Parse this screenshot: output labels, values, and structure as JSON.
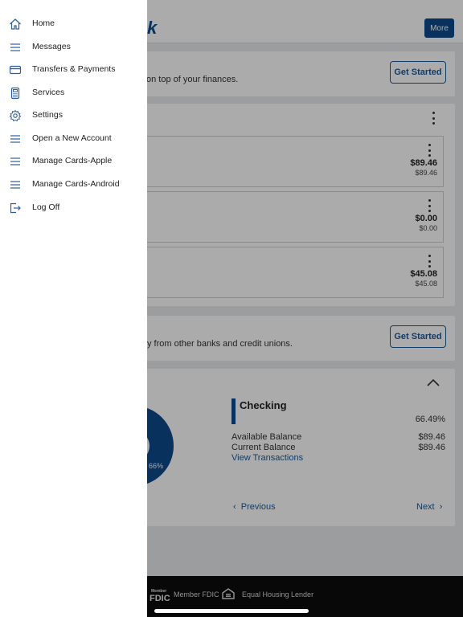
{
  "app": {
    "logo_fragment": "k",
    "more_label": "More"
  },
  "promo_top": {
    "text_fragment": "on top of your finances.",
    "button_label": "Get Started"
  },
  "accounts": [
    {
      "amount": "$89.46",
      "sub_amount": "$89.46"
    },
    {
      "amount": "$0.00",
      "sub_amount": "$0.00"
    },
    {
      "amount": "$45.08",
      "sub_amount": "$45.08"
    }
  ],
  "promo_bottom": {
    "text_fragment": "y from other banks and credit unions.",
    "button_label": "Get Started"
  },
  "breakdown": {
    "title": "Checking",
    "percent": "66.49%",
    "donut_label": "66%",
    "available_label": "Available Balance",
    "available_value": "$89.46",
    "current_label": "Current Balance",
    "current_value": "$89.46",
    "view_transactions": "View Transactions",
    "previous": "Previous",
    "next": "Next"
  },
  "footer": {
    "fdic_logo_text": "Member FDIC",
    "member_fdic": "Member FDIC",
    "equal_housing": "Equal Housing Lender"
  },
  "drawer": {
    "items": [
      {
        "label": "Home",
        "icon": "home-icon"
      },
      {
        "label": "Messages",
        "icon": "list-icon"
      },
      {
        "label": "Transfers & Payments",
        "icon": "card-icon"
      },
      {
        "label": "Services",
        "icon": "calculator-icon"
      },
      {
        "label": "Settings",
        "icon": "gear-icon"
      },
      {
        "label": "Open a New Account",
        "icon": "list-icon"
      },
      {
        "label": "Manage Cards-Apple",
        "icon": "list-icon"
      },
      {
        "label": "Manage Cards-Android",
        "icon": "list-icon"
      },
      {
        "label": "Log Off",
        "icon": "logout-icon"
      }
    ]
  },
  "colors": {
    "brand": "#0d4a8c",
    "icon": "#2f5e97",
    "link": "#1a5a9c"
  }
}
